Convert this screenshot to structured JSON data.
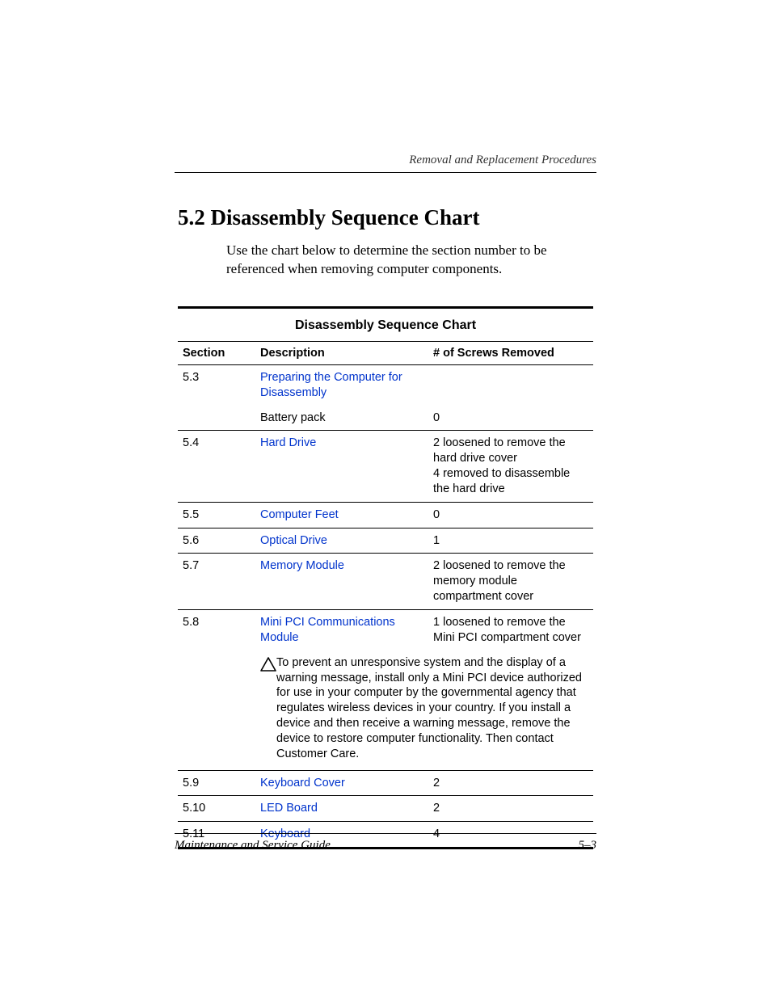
{
  "running_header": "Removal and Replacement Procedures",
  "heading": "5.2 Disassembly Sequence Chart",
  "intro": "Use the chart below to determine the section number to be referenced when removing computer components.",
  "table_title": "Disassembly Sequence Chart",
  "headers": {
    "section": "Section",
    "description": "Description",
    "screws": "# of Screws Removed"
  },
  "rows": {
    "r53_section": "5.3",
    "r53_desc": "Preparing the Computer for Disassembly",
    "r53_screws": "",
    "r53b_desc": "Battery pack",
    "r53b_screws": "0",
    "r54_section": "5.4",
    "r54_desc": "Hard Drive",
    "r54_screws1": "2 loosened to remove the hard drive cover",
    "r54_screws2": "4 removed to disassemble the hard drive",
    "r55_section": "5.5",
    "r55_desc": "Computer Feet",
    "r55_screws": "0",
    "r56_section": "5.6",
    "r56_desc": "Optical Drive",
    "r56_screws": "1",
    "r57_section": "5.7",
    "r57_desc": "Memory Module",
    "r57_screws": "2 loosened to remove the memory module compartment cover",
    "r58_section": "5.8",
    "r58_desc": "Mini PCI Communications Module",
    "r58_screws": "1 loosened to remove the Mini PCI compartment cover",
    "caution": "To prevent an unresponsive system and the display of a warning message, install only a Mini PCI device authorized for use in your computer by the governmental agency that regulates wireless devices in your country. If you install a device and then receive a warning message, remove the device to restore computer functionality. Then contact Customer Care.",
    "r59_section": "5.9",
    "r59_desc": "Keyboard Cover",
    "r59_screws": "2",
    "r510_section": "5.10",
    "r510_desc": "LED Board",
    "r510_screws": "2",
    "r511_section": "5.11",
    "r511_desc": "Keyboard",
    "r511_screws": "4"
  },
  "footer": {
    "left": "Maintenance and Service Guide",
    "right": "5–3"
  }
}
